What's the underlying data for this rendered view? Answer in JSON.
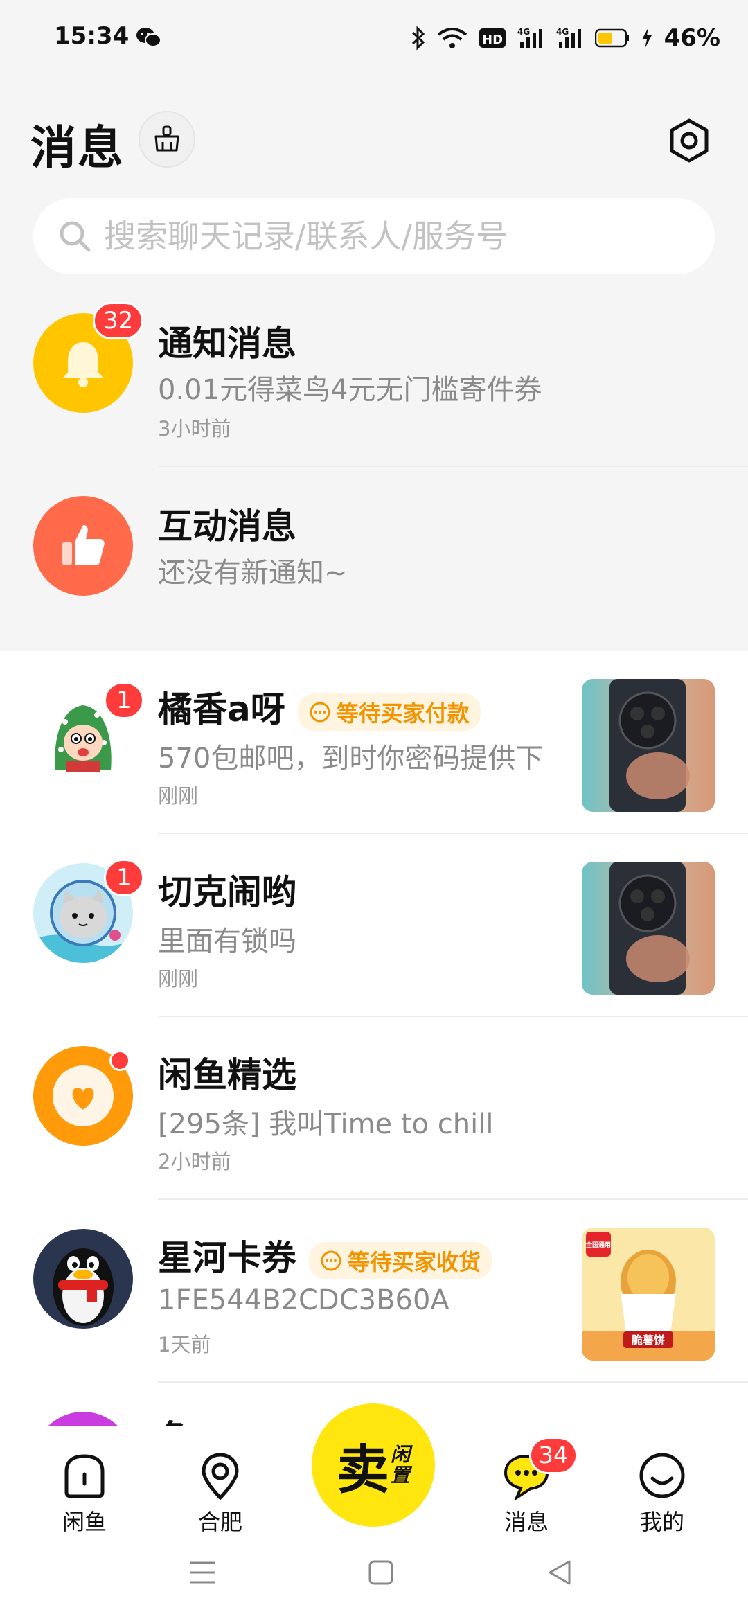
{
  "status_bar": {
    "time": "15:34",
    "battery_percent": "46%",
    "icons": [
      "wechat-icon",
      "bluetooth-icon",
      "wifi-icon",
      "hd-icon",
      "signal-4g-icon",
      "signal-4g-icon",
      "battery-icon",
      "charging-icon"
    ]
  },
  "header": {
    "title": "消息"
  },
  "search": {
    "placeholder": "搜索聊天记录/联系人/服务号"
  },
  "system_rows": [
    {
      "title": "通知消息",
      "subtitle": "0.01元得菜鸟4元无门槛寄件券",
      "time": "3小时前",
      "badge": "32",
      "icon": "bell-icon",
      "color": "#ffc600"
    },
    {
      "title": "互动消息",
      "subtitle": "还没有新通知~",
      "time": "",
      "badge": "",
      "icon": "thumbs-up-icon",
      "color": "#ff6a4a"
    }
  ],
  "chats": [
    {
      "name": "橘香a呀",
      "tag": "等待买家付款",
      "message": "570包邮吧，到时你密码提供下",
      "time": "刚刚",
      "badge": "1",
      "has_thumb": true
    },
    {
      "name": "切克闹哟",
      "tag": "",
      "message": "里面有锁吗",
      "time": "刚刚",
      "badge": "1",
      "has_thumb": true
    },
    {
      "name": "闲鱼精选",
      "tag": "",
      "message": "[295条] 我叫Time to chill",
      "time": "2小时前",
      "badge": "dot",
      "has_thumb": false
    },
    {
      "name": "星河卡券",
      "tag": "等待买家收货",
      "message": "1FE544B2CDC3B60A",
      "time": "1天前",
      "badge": "",
      "has_thumb": true,
      "thumb_label": "脆薯饼",
      "thumb_corner": "全国通用"
    },
    {
      "name": "鱼",
      "tag": "",
      "message": "",
      "time": "",
      "badge": "",
      "has_thumb": false
    }
  ],
  "bottom_nav": {
    "items": [
      {
        "label": "闲鱼",
        "icon": "home-icon"
      },
      {
        "label": "合肥",
        "icon": "location-icon"
      },
      {
        "label": "消息",
        "icon": "message-icon",
        "badge": "34"
      },
      {
        "label": "我的",
        "icon": "smile-icon"
      }
    ],
    "sell_main": "卖",
    "sell_sub_1": "闲",
    "sell_sub_2": "置"
  },
  "colors": {
    "accent_yellow": "#ffe60f",
    "badge_red": "#ff3b3b",
    "tag_orange": "#f29400",
    "background_top": "#f5f5f5"
  }
}
